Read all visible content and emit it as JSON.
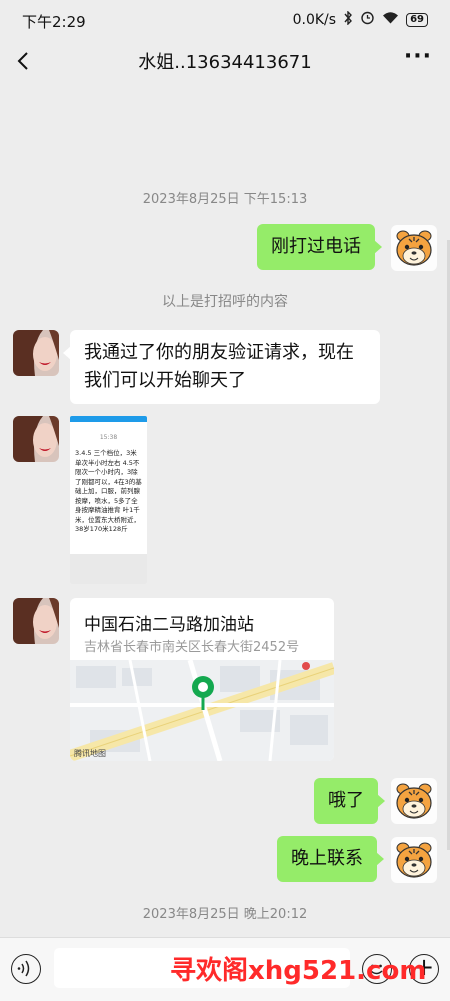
{
  "status_bar": {
    "time": "下午2:29",
    "speed": "0.0K/s",
    "battery": "69"
  },
  "header": {
    "title": "水姐..13634413671"
  },
  "messages": {
    "ts1": "2023年8月25日 下午15:13",
    "m1_text": "刚打过电话",
    "system_note": "以上是打招呼的内容",
    "m2_line1": "我通过了你的朋友验证请求，现在",
    "m2_line2": "我们可以开始聊天了",
    "shot_time": "15:38",
    "shot_text": "3.4.5 三个档位，3米单次半小时左右 4.5不限次一个小时内，3除了刚都可以，4在3的基础上加，口服，前列腺按摩，喷水，5多了全身按摩精油推背 叶1千米，位置东大桥附近，38岁170米128斤",
    "loc_title": "中国石油二马路加油站",
    "loc_address": "吉林省长春市南关区长春大街2452号",
    "map_credit": "腾讯地图",
    "m3_text": "哦了",
    "m4_text": "晚上联系",
    "ts2": "2023年8月25日 晚上20:12"
  },
  "input_bar": {
    "value": "",
    "placeholder": ""
  },
  "watermark": "寻欢阁xhg521.com",
  "icons": {
    "back": "chevron-left-icon",
    "more": "more-dots-icon",
    "voice": "voice-icon",
    "emoji": "emoji-icon",
    "plus": "plus-icon"
  },
  "colors": {
    "bubble_self": "#95ec69",
    "bubble_other": "#ffffff",
    "background": "#ededed",
    "watermark": "#ff2a2a"
  }
}
